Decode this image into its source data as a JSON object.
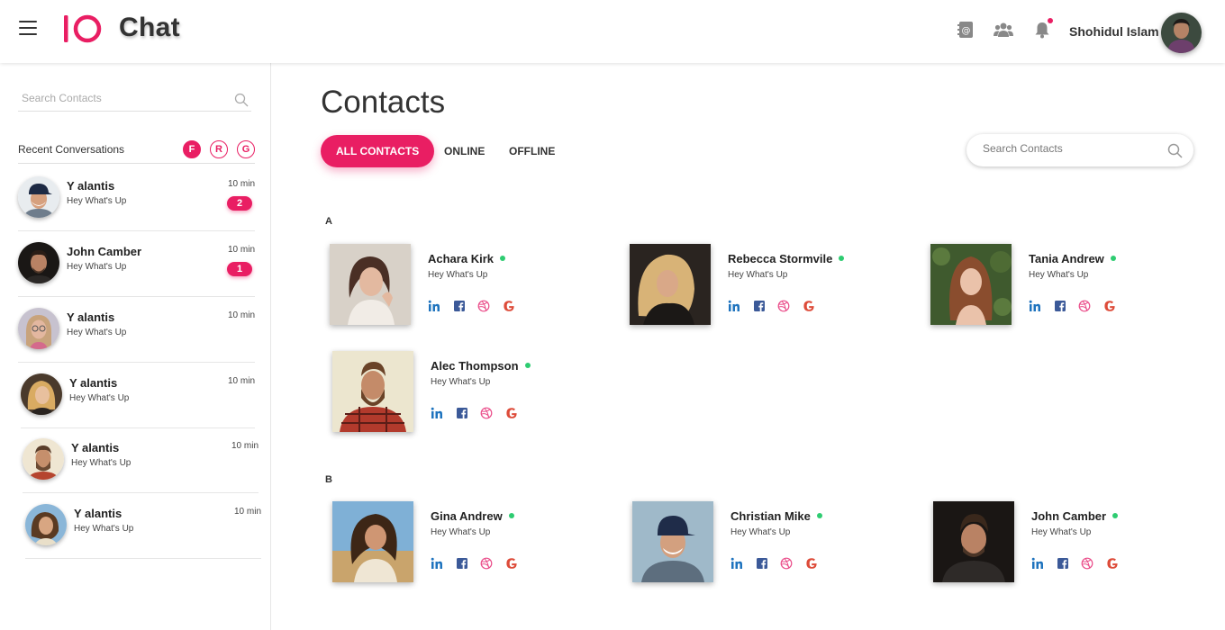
{
  "app": {
    "title": "Chat"
  },
  "header": {
    "user_name": "Shohidul Islam",
    "icons": [
      "hamburger-menu-icon",
      "address-book-icon",
      "group-icon",
      "bell-icon"
    ],
    "accent_color": "#e91e63"
  },
  "sidebar": {
    "search_placeholder": "Search Contacts",
    "recent_title": "Recent Conversations",
    "filters": [
      {
        "label": "F",
        "active": true
      },
      {
        "label": "R",
        "active": false
      },
      {
        "label": "G",
        "active": false
      }
    ],
    "conversations": [
      {
        "name": "Y alantis",
        "message": "Hey What's Up",
        "time": "10 min",
        "badge": "2"
      },
      {
        "name": "John Camber",
        "message": "Hey What's Up",
        "time": "10 min",
        "badge": "1"
      },
      {
        "name": "Y alantis",
        "message": "Hey What's Up",
        "time": "10 min",
        "badge": null
      },
      {
        "name": "Y alantis",
        "message": "Hey What's Up",
        "time": "10 min",
        "badge": null
      },
      {
        "name": "Y alantis",
        "message": "Hey What's Up",
        "time": "10 min",
        "badge": null
      },
      {
        "name": "Y alantis",
        "message": "Hey What's Up",
        "time": "10 min",
        "badge": null
      }
    ]
  },
  "main": {
    "title": "Contacts",
    "tabs": [
      {
        "label": "ALL CONTACTS",
        "active": true
      },
      {
        "label": "ONLINE",
        "active": false
      },
      {
        "label": "OFFLINE",
        "active": false
      }
    ],
    "search_placeholder": "Search Contacts",
    "groups": [
      {
        "letter": "A",
        "contacts": [
          {
            "name": "Achara Kirk",
            "message": "Hey What's Up",
            "online": true
          },
          {
            "name": "Rebecca Stormvile",
            "message": "Hey What's Up",
            "online": true
          },
          {
            "name": "Tania Andrew",
            "message": "Hey What's Up",
            "online": true
          },
          {
            "name": "Alec Thompson",
            "message": "Hey What's Up",
            "online": true
          }
        ]
      },
      {
        "letter": "B",
        "contacts": [
          {
            "name": "Gina Andrew",
            "message": "Hey What's Up",
            "online": true
          },
          {
            "name": "Christian Mike",
            "message": "Hey What's Up",
            "online": true
          },
          {
            "name": "John Camber",
            "message": "Hey What's Up",
            "online": true
          }
        ]
      }
    ],
    "social_icons": [
      "linkedin-icon",
      "facebook-icon",
      "dribbble-icon",
      "google-icon"
    ],
    "social_colors": {
      "linkedin": "#1e73be",
      "facebook": "#3b5998",
      "dribbble": "#ea4c89",
      "google": "#dd4b39"
    },
    "online_color": "#2ecc71"
  }
}
